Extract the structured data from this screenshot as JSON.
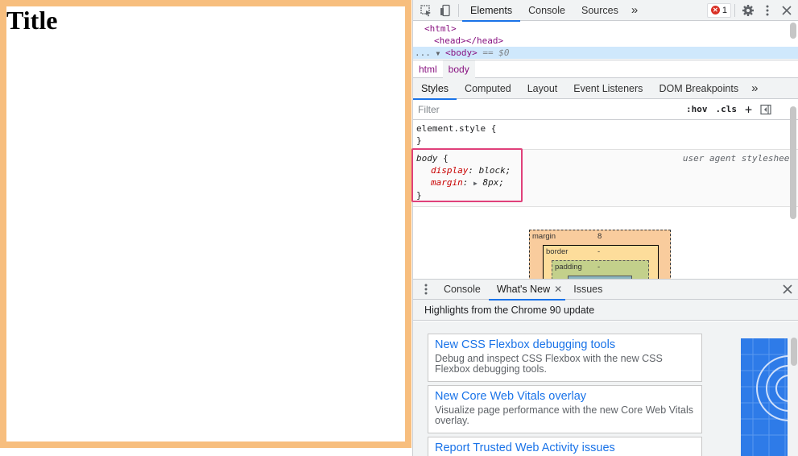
{
  "viewport": {
    "page_title": "Title"
  },
  "devtools": {
    "main_tabs": [
      "Elements",
      "Console",
      "Sources"
    ],
    "more_tabs": "»",
    "error_count": "1",
    "dom": {
      "html_open": "<html>",
      "head": "<head></head>",
      "body_open": "<body>",
      "selected_marker": "== $0",
      "ellipsis": "..."
    },
    "breadcrumb": [
      "html",
      "body"
    ],
    "styles_tabs": [
      "Styles",
      "Computed",
      "Layout",
      "Event Listeners",
      "DOM Breakpoints"
    ],
    "filter_placeholder": "Filter",
    "hov": ":hov",
    "cls": ".cls",
    "element_style": {
      "selector": "element.style {",
      "close": "}"
    },
    "rule": {
      "selector": "body",
      "open": " {",
      "source": "user agent stylesheet",
      "decl1_prop": "display",
      "decl1_val": "block;",
      "decl2_prop": "margin",
      "decl2_val": "8px;",
      "close": "}"
    },
    "box_model": {
      "margin_label": "margin",
      "margin_val": "8",
      "border_label": "border",
      "border_val": "-",
      "padding_label": "padding",
      "padding_val": "-"
    },
    "drawer": {
      "tabs": [
        "Console",
        "What's New",
        "Issues"
      ],
      "subtitle": "Highlights from the Chrome 90 update",
      "cards": [
        {
          "title": "New CSS Flexbox debugging tools",
          "desc": "Debug and inspect CSS Flexbox with the new CSS Flexbox debugging tools."
        },
        {
          "title": "New Core Web Vitals overlay",
          "desc": "Visualize page performance with the new Core Web Vitals overlay."
        },
        {
          "title": "Report Trusted Web Activity issues",
          "desc": ""
        }
      ]
    }
  },
  "colors": {
    "accent": "#1a73e8",
    "highlight": "#e0407a",
    "page_margin": "#f7be7e"
  }
}
